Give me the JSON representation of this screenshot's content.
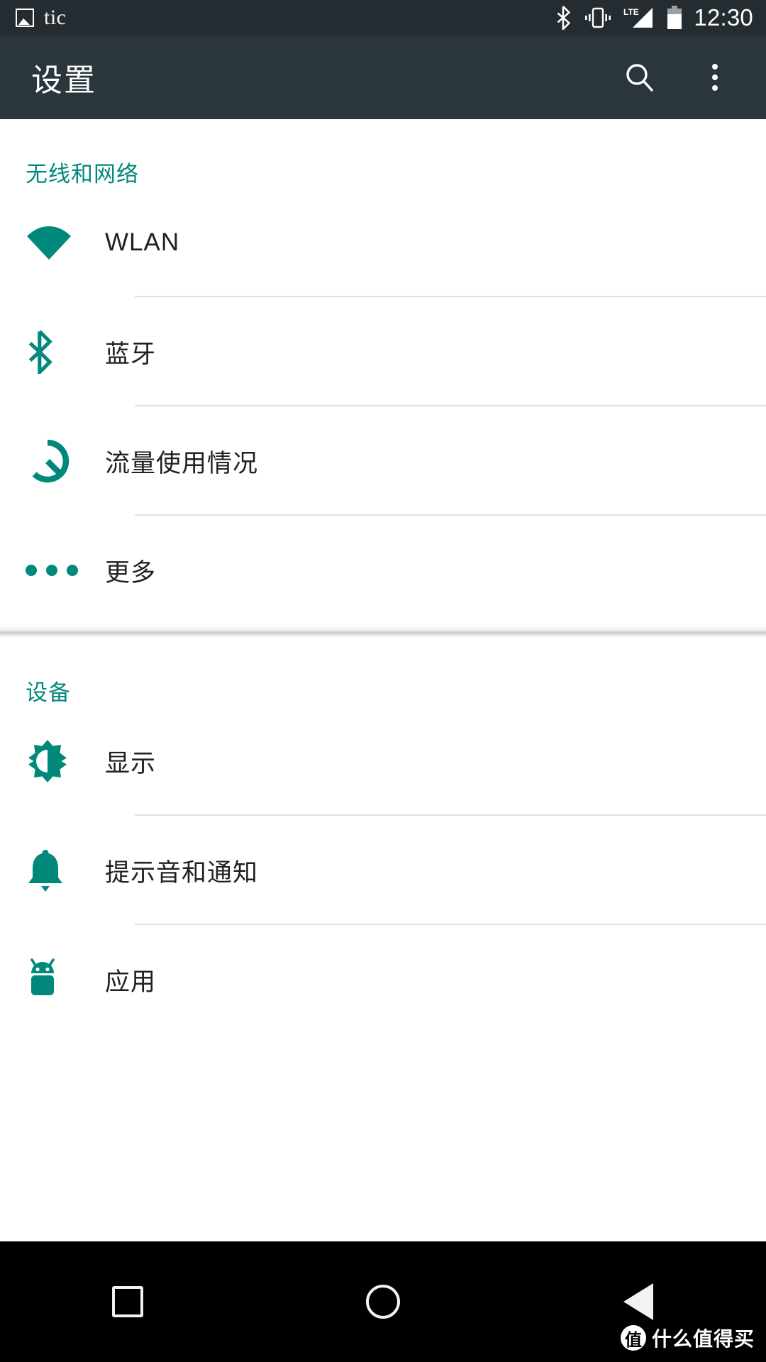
{
  "status_bar": {
    "app_icon": "gallery-icon",
    "app_name": "tic",
    "icons": [
      "bluetooth-icon",
      "vibrate-icon",
      "lte-signal-icon",
      "battery-icon"
    ],
    "time": "12:30"
  },
  "app_bar": {
    "title": "设置",
    "search_icon": "search-icon",
    "overflow_icon": "overflow-menu-icon"
  },
  "colors": {
    "accent": "#00897b",
    "app_bar": "#2b363c",
    "status_bar": "#242c31",
    "divider": "#e0e0e0",
    "label": "#212121",
    "nav_bar": "#000000"
  },
  "sections": [
    {
      "header": "无线和网络",
      "rows": [
        {
          "label": "WLAN",
          "icon": "wifi-icon"
        },
        {
          "label": "蓝牙",
          "icon": "bluetooth-icon"
        },
        {
          "label": "流量使用情况",
          "icon": "data-usage-icon"
        },
        {
          "label": "更多",
          "icon": "more-dots-icon"
        }
      ]
    },
    {
      "header": "设备",
      "rows": [
        {
          "label": "显示",
          "icon": "brightness-icon"
        },
        {
          "label": "提示音和通知",
          "icon": "bell-icon"
        },
        {
          "label": "应用",
          "icon": "android-robot-icon"
        }
      ]
    }
  ],
  "nav_bar": {
    "recents_label": "recents",
    "home_label": "home",
    "back_label": "back"
  },
  "watermark": {
    "badge": "值",
    "text": "什么值得买"
  }
}
